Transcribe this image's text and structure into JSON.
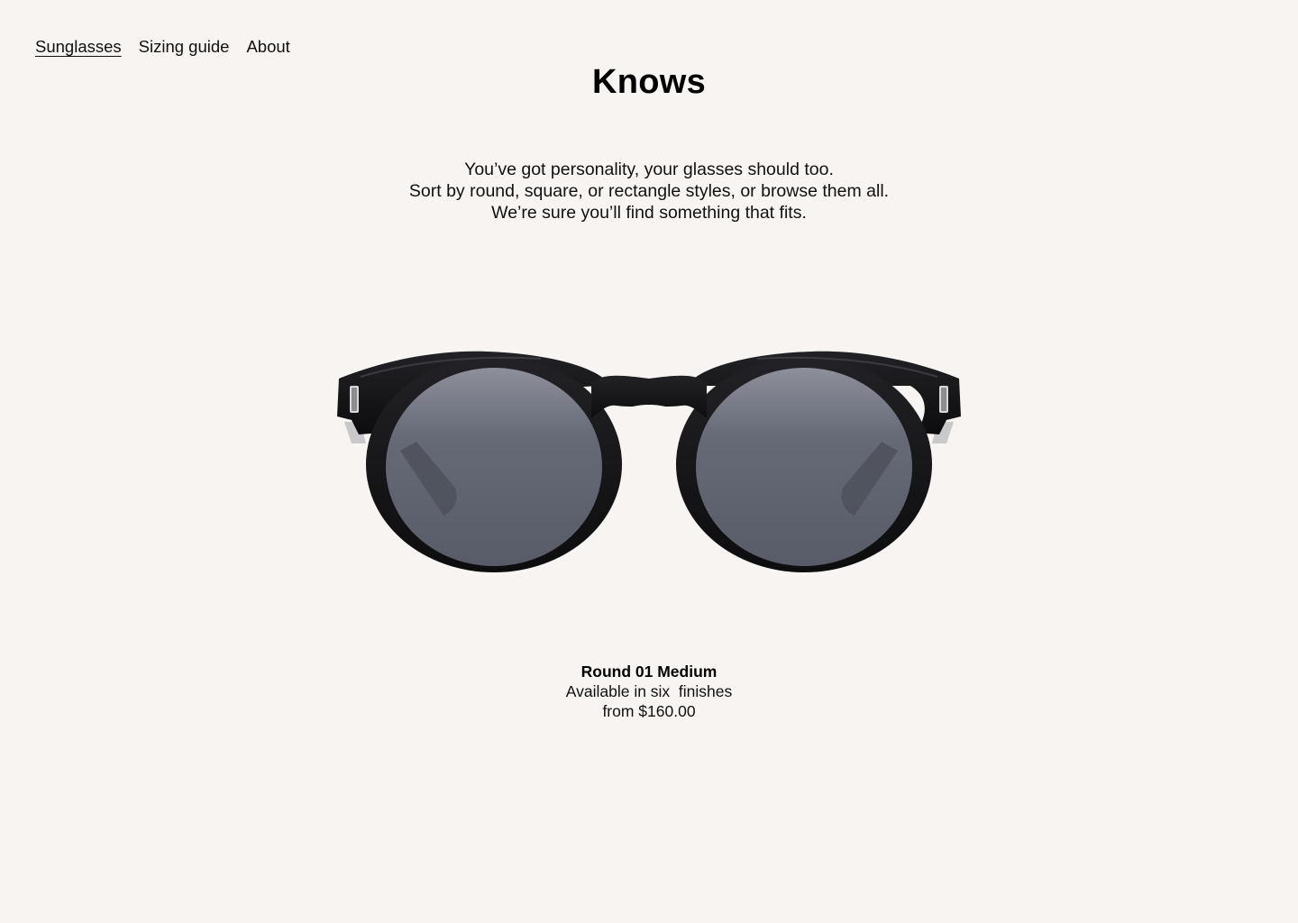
{
  "nav": {
    "items": [
      {
        "label": "Sunglasses",
        "active": true
      },
      {
        "label": "Sizing guide",
        "active": false
      },
      {
        "label": "About",
        "active": false
      }
    ]
  },
  "brand": {
    "title": "Knows"
  },
  "intro": {
    "lines": [
      "You’ve got personality, your glasses should too.",
      "Sort by round, square, or rectangle styles, or browse them all.",
      "We’re sure you’ll find something that fits."
    ]
  },
  "product": {
    "name": "Round 01 Medium",
    "availability": "Available in six  finishes",
    "price": "from $160.00",
    "image_icon": "round-sunglasses-icon"
  },
  "colors": {
    "background": "#f7f4f2",
    "text": "#111111",
    "frame": "#141416",
    "lens": "#5a5e6a"
  }
}
